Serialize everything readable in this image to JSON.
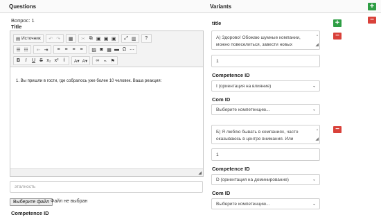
{
  "header": {
    "questions_label": "Questions",
    "variants_label": "Variants",
    "add_icon": "plus-icon"
  },
  "question": {
    "number_label": "Вопрос: 1",
    "title_label": "Title",
    "editor": {
      "source_label": "Источник",
      "content": "1. Вы пришли в гости, где собралось уже более 10 человек. Ваша реакция:"
    },
    "extra_input": {
      "placeholder": "эталность"
    },
    "file": {
      "button_label": "Выберите файл",
      "status": "Файл не выбран"
    },
    "competence_label": "Competence ID"
  },
  "variants": {
    "title_label": "title",
    "items": [
      {
        "text": "А) Здорово! Обожаю шумные компании, можно повеселиться, завести новых",
        "score": "1",
        "competence_label": "Competence ID",
        "competence_value": "I (ориентация на влияние)",
        "com_label": "Com ID",
        "com_value": "Выберите компетенцию..."
      },
      {
        "text": "Б) Я люблю бывать в компаниях, часто оказываюсь в центре внимания. Или",
        "score": "1",
        "competence_label": "Competence ID",
        "competence_value": "D (ориентация на доминирование)",
        "com_label": "Com ID",
        "com_value": "Выберите компетенцию..."
      }
    ]
  },
  "colors": {
    "add": "#2e9e44",
    "remove": "#d9413a"
  }
}
